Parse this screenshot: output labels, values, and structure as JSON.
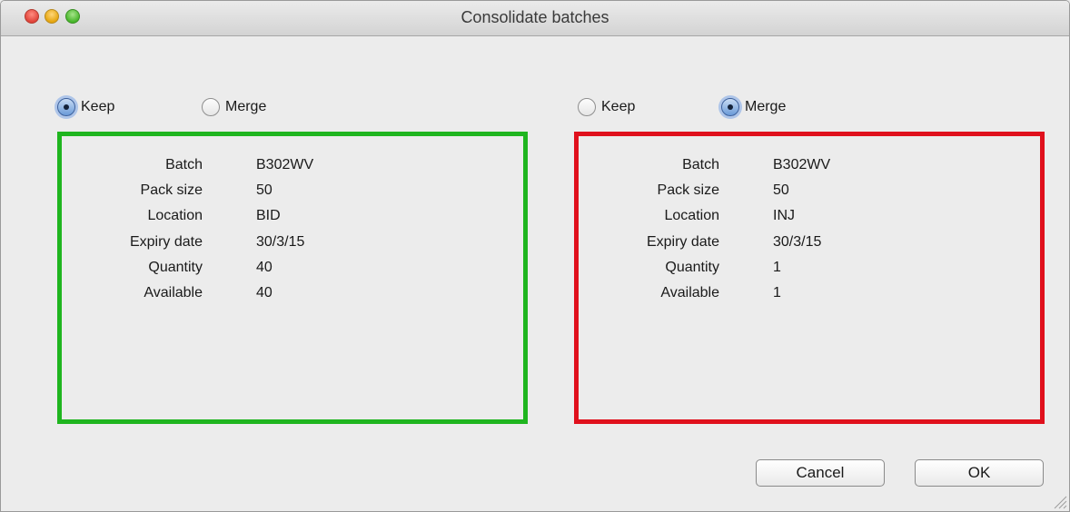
{
  "window": {
    "title": "Consolidate batches"
  },
  "colors": {
    "keep_border": "#1fb51f",
    "merge_border": "#e0101c"
  },
  "left": {
    "radios": [
      {
        "label": "Keep",
        "checked": true
      },
      {
        "label": "Merge",
        "checked": false
      }
    ],
    "fields": [
      {
        "key": "Batch",
        "value": "B302WV"
      },
      {
        "key": "Pack size",
        "value": "50"
      },
      {
        "key": "Location",
        "value": "BID"
      },
      {
        "key": "Expiry date",
        "value": "30/3/15"
      },
      {
        "key": "Quantity",
        "value": "40"
      },
      {
        "key": "Available",
        "value": "40"
      }
    ]
  },
  "right": {
    "radios": [
      {
        "label": "Keep",
        "checked": false
      },
      {
        "label": "Merge",
        "checked": true
      }
    ],
    "fields": [
      {
        "key": "Batch",
        "value": "B302WV"
      },
      {
        "key": "Pack size",
        "value": "50"
      },
      {
        "key": "Location",
        "value": "INJ"
      },
      {
        "key": "Expiry date",
        "value": "30/3/15"
      },
      {
        "key": "Quantity",
        "value": "1"
      },
      {
        "key": "Available",
        "value": "1"
      }
    ]
  },
  "buttons": {
    "cancel": "Cancel",
    "ok": "OK"
  }
}
